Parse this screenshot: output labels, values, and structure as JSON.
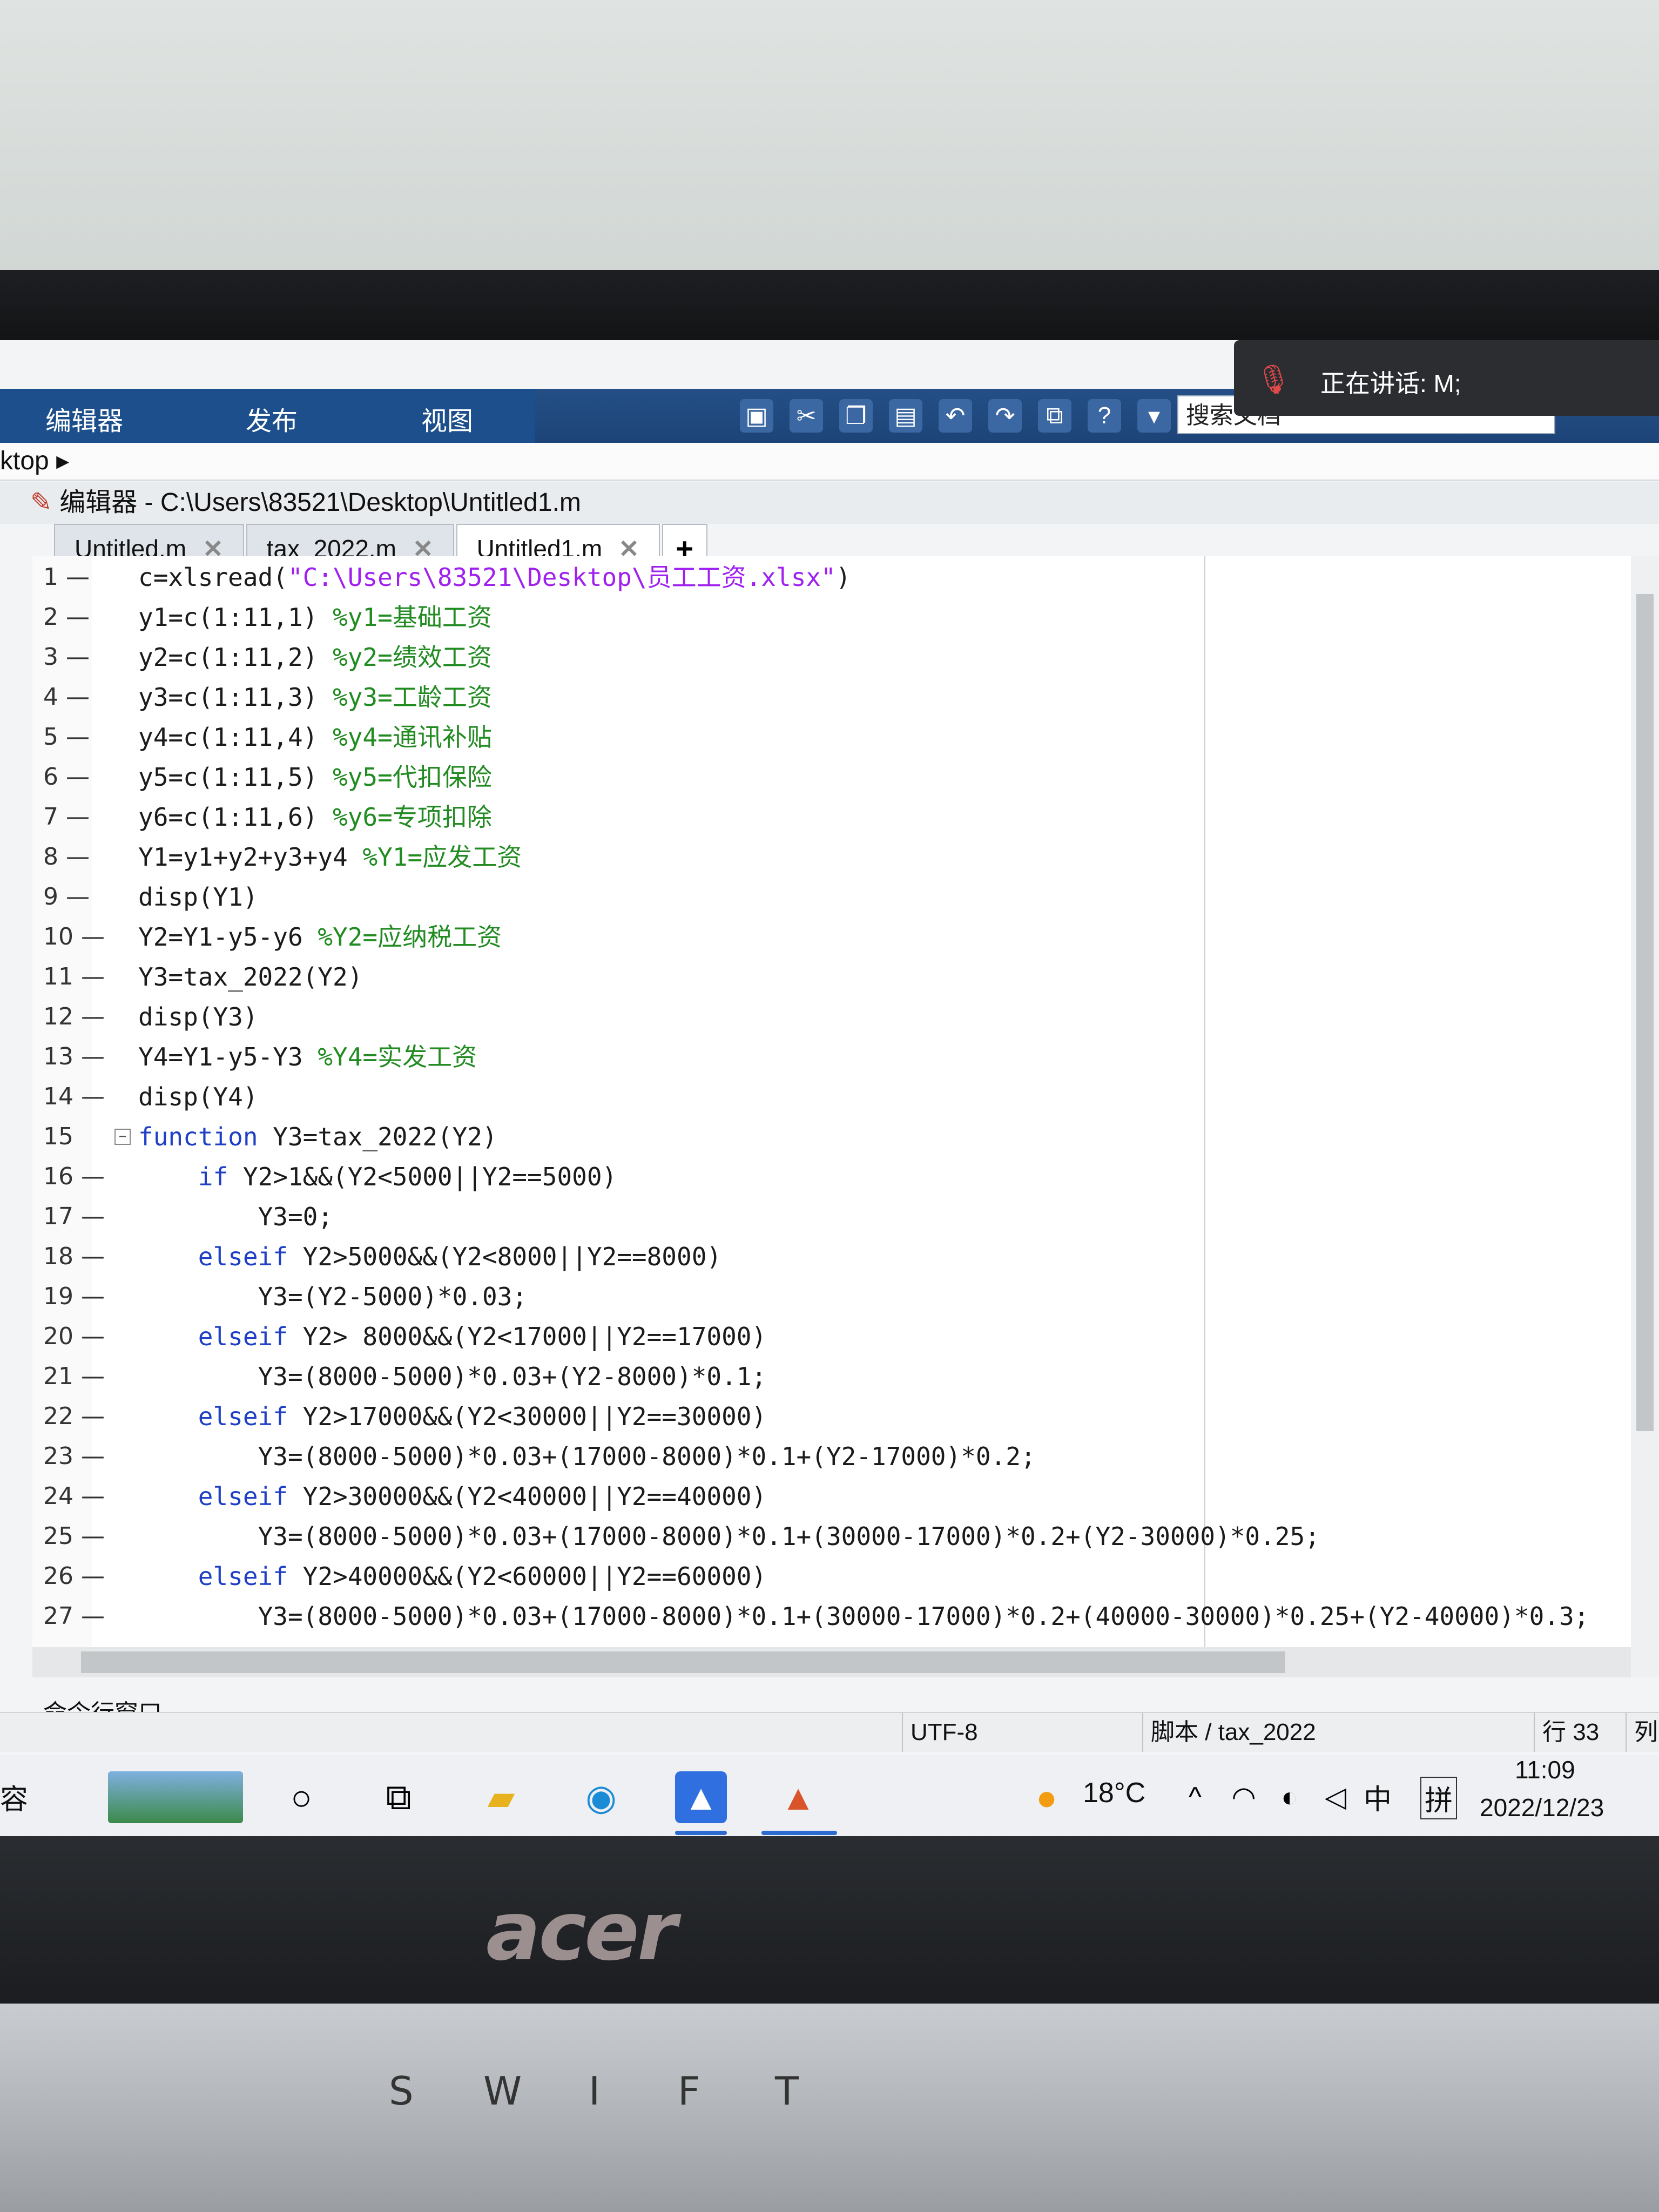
{
  "ribbon": {
    "tabs": [
      "编辑器",
      "发布",
      "视图"
    ],
    "search_value": "搜索文档"
  },
  "toast": {
    "text": "正在讲话: M;"
  },
  "address": {
    "path": "ktop ▸"
  },
  "editor": {
    "title": "编辑器 - C:\\Users\\83521\\Desktop\\Untitled1.m",
    "tabs": [
      {
        "label": "Untitled.m"
      },
      {
        "label": "tax_2022.m"
      },
      {
        "label": "Untitled1.m"
      }
    ],
    "add_tab": "+",
    "lines": [
      {
        "n": "1 —",
        "text": "c=xlsread(\"C:\\Users\\83521\\Desktop\\员工工资.xlsx\")"
      },
      {
        "n": "2 —",
        "text": "y1=c(1:11,1)",
        "comment": "%y1=基础工资"
      },
      {
        "n": "3 —",
        "text": "y2=c(1:11,2)",
        "comment": "%y2=绩效工资"
      },
      {
        "n": "4 —",
        "text": "y3=c(1:11,3)",
        "comment": "%y3=工龄工资"
      },
      {
        "n": "5 —",
        "text": "y4=c(1:11,4)",
        "comment": "%y4=通讯补贴"
      },
      {
        "n": "6 —",
        "text": "y5=c(1:11,5)",
        "comment": "%y5=代扣保险"
      },
      {
        "n": "7 —",
        "text": "y6=c(1:11,6)",
        "comment": "%y6=专项扣除"
      },
      {
        "n": "8 —",
        "text": "Y1=y1+y2+y3+y4",
        "comment": "%Y1=应发工资"
      },
      {
        "n": "9 —",
        "text": "disp(Y1)"
      },
      {
        "n": "10 —",
        "text": "Y2=Y1-y5-y6",
        "comment": "%Y2=应纳税工资"
      },
      {
        "n": "11 —",
        "text": "Y3=tax_2022(Y2)"
      },
      {
        "n": "12 —",
        "text": "disp(Y3)"
      },
      {
        "n": "13 —",
        "text": "Y4=Y1-y5-Y3",
        "comment": "%Y4=实发工资"
      },
      {
        "n": "14 —",
        "text": "disp(Y4)"
      },
      {
        "n": "15",
        "kw": "function",
        "text": " Y3=tax_2022(Y2)"
      },
      {
        "n": "16 —",
        "indent": "    ",
        "kw": "if",
        "text": " Y2>1&&(Y2<5000||Y2==5000)"
      },
      {
        "n": "17 —",
        "indent": "        ",
        "text": "Y3=0;"
      },
      {
        "n": "18 —",
        "indent": "    ",
        "kw": "elseif",
        "text": " Y2>5000&&(Y2<8000||Y2==8000)"
      },
      {
        "n": "19 —",
        "indent": "        ",
        "text": "Y3=(Y2-5000)*0.03;"
      },
      {
        "n": "20 —",
        "indent": "    ",
        "kw": "elseif",
        "text": " Y2> 8000&&(Y2<17000||Y2==17000)"
      },
      {
        "n": "21 —",
        "indent": "        ",
        "text": "Y3=(8000-5000)*0.03+(Y2-8000)*0.1;"
      },
      {
        "n": "22 —",
        "indent": "    ",
        "kw": "elseif",
        "text": " Y2>17000&&(Y2<30000||Y2==30000)"
      },
      {
        "n": "23 —",
        "indent": "        ",
        "text": "Y3=(8000-5000)*0.03+(17000-8000)*0.1+(Y2-17000)*0.2;"
      },
      {
        "n": "24 —",
        "indent": "    ",
        "kw": "elseif",
        "text": " Y2>30000&&(Y2<40000||Y2==40000)"
      },
      {
        "n": "25 —",
        "indent": "        ",
        "text": "Y3=(8000-5000)*0.03+(17000-8000)*0.1+(30000-17000)*0.2+(Y2-30000)*0.25;"
      },
      {
        "n": "26 —",
        "indent": "    ",
        "kw": "elseif",
        "text": " Y2>40000&&(Y2<60000||Y2==60000)"
      },
      {
        "n": "27 —",
        "indent": "        ",
        "text": "Y3=(8000-5000)*0.03+(17000-8000)*0.1+(30000-17000)*0.2+(40000-30000)*0.25+(Y2-40000)*0.3;"
      }
    ]
  },
  "command_window": {
    "label": "命令行窗口"
  },
  "status": {
    "encoding": "UTF-8",
    "file_type": "脚本 / tax_2022",
    "row": "行 33",
    "col": "列"
  },
  "taskbar": {
    "left_text": "容",
    "weather_temp": "18°C",
    "ime_lang": "中",
    "ime_mode": "拼",
    "time": "11:09",
    "date": "2022/12/23"
  },
  "laptop": {
    "brand": "acer",
    "keys": [
      "S",
      "W",
      "I",
      "F",
      "T"
    ]
  },
  "colors": {
    "ribbon_blue": "#1c4f8c",
    "keyword": "#1f3fc4",
    "string": "#a020f0",
    "comment": "#228b22"
  }
}
